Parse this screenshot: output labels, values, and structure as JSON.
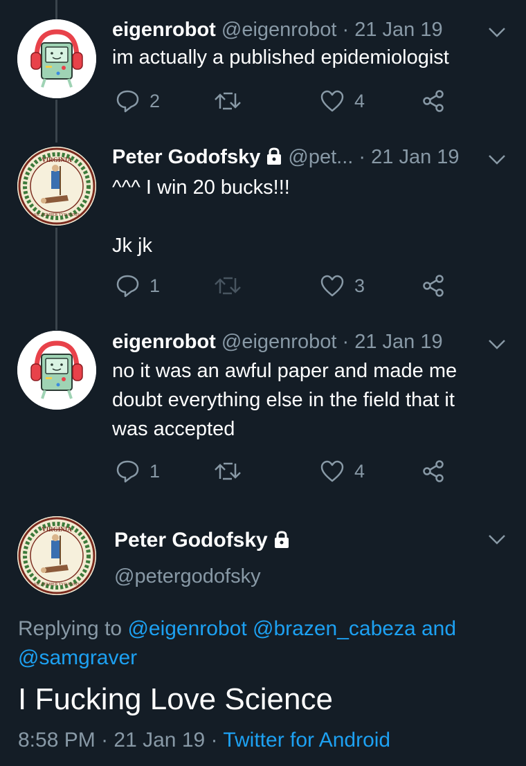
{
  "tweets": [
    {
      "name": "eigenrobot",
      "handle": "@eigenrobot",
      "date": "21 Jan 19",
      "text": [
        "im actually a published epidemiologist"
      ],
      "replies": "2",
      "likes": "4"
    },
    {
      "name": "Peter Godofsky",
      "handle": "@pet...",
      "date": "21 Jan 19",
      "text": [
        "^^^ I win 20 bucks!!!",
        "",
        "Jk jk"
      ],
      "replies": "1",
      "likes": "3"
    },
    {
      "name": "eigenrobot",
      "handle": "@eigenrobot",
      "date": "21 Jan 19",
      "text": [
        "no it was an awful paper and made me",
        "doubt everything else in the field that it",
        "was accepted"
      ],
      "replies": "1",
      "likes": "4"
    }
  ],
  "focus": {
    "name": "Peter Godofsky",
    "handle": "@petergodofsky",
    "replying_prefix": "Replying to",
    "mention1": "@eigenrobot",
    "mention2": "@brazen_cabeza",
    "and_word": "and",
    "mention3": "@samgraver",
    "text": "I Fucking Love Science",
    "time": "8:58 PM",
    "date": "21 Jan 19",
    "source": "Twitter for Android"
  },
  "avatars": {
    "bmo_seal": "bmo-with-headphones",
    "virginia_seal": "virginia-state-seal",
    "seal_top_text": "VIRGINIA",
    "seal_motto": "SIC SEMPER TYRANNIS"
  },
  "colors": {
    "background": "#141d26",
    "muted": "#8899a6",
    "link": "#1da1f2",
    "thread_line": "#3a444c"
  }
}
